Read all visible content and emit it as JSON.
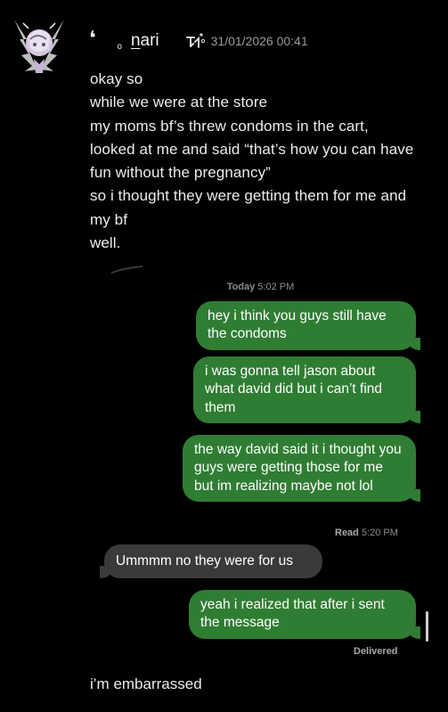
{
  "post": {
    "header": {
      "deco_left": "❛",
      "deco_mid": "ₒ",
      "username_first": "n",
      "username_rest": "ari",
      "badge_icon": "stylized-t-sparkle-icon",
      "timestamp": "31/01/2026 00:41"
    },
    "avatar_icon": "winged-character-avatar",
    "lines": [
      "okay so",
      "while we were at the store",
      "my moms bf’s threw condoms in the cart,",
      "looked at me and said “that’s how you can have",
      "fun without the pregnancy”",
      "so i thought they were getting them for me and",
      "my bf",
      "well."
    ],
    "closing_line": "i’m embarrassed"
  },
  "screenshot": {
    "day_label_bold": "Today",
    "day_label_time": "5:02 PM",
    "messages": [
      {
        "direction": "sent",
        "text": "hey i think you guys still have the condoms"
      },
      {
        "direction": "sent",
        "text": "i was gonna tell jason about what david did but i can’t find them"
      },
      {
        "direction": "sent",
        "text": "the way david said it i thought you guys were getting those for me but im realizing maybe not lol"
      },
      {
        "direction": "received",
        "text": "Ummmm no they were for us"
      },
      {
        "direction": "sent",
        "text": "yeah i realized that after i sent the message"
      }
    ],
    "read_receipt_bold": "Read",
    "read_receipt_time": "5:20 PM",
    "delivered_label": "Delivered"
  },
  "colors": {
    "background": "#000000",
    "sent_bubble": "#2f7d32",
    "received_bubble": "#3a3a3c",
    "meta_text": "#8c8c8c"
  }
}
